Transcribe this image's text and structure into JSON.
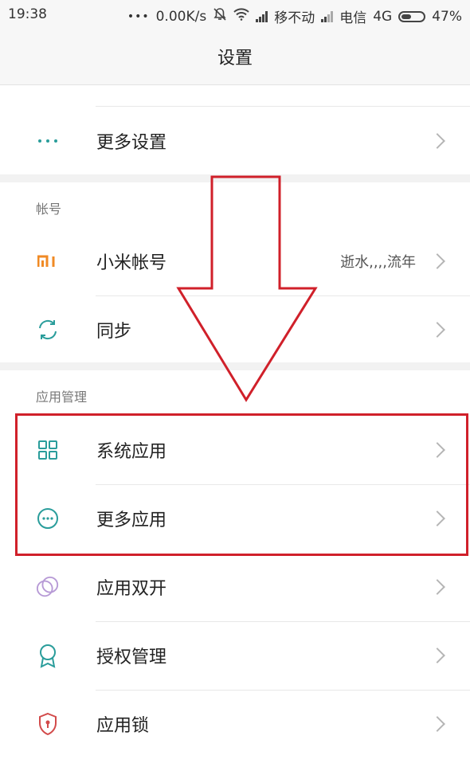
{
  "status_bar": {
    "time": "19:38",
    "dots": "•••",
    "speed": "0.00K/s",
    "carrier1": "移不动",
    "carrier2": "电信",
    "network": "4G",
    "battery": "47%",
    "battery_level": 0.47
  },
  "header": {
    "title": "设置"
  },
  "groups": [
    {
      "items": [
        {
          "label": "更多设置",
          "icon": "more-dots-icon"
        }
      ]
    },
    {
      "header": "帐号",
      "items": [
        {
          "label": "小米帐号",
          "value": "逝水,,,,流年",
          "icon": "mi-logo-icon"
        },
        {
          "label": "同步",
          "icon": "sync-icon"
        }
      ]
    },
    {
      "header": "应用管理",
      "items": [
        {
          "label": "系统应用",
          "icon": "grid-icon"
        },
        {
          "label": "更多应用",
          "icon": "more-circle-icon"
        },
        {
          "label": "应用双开",
          "icon": "dual-circle-icon"
        },
        {
          "label": "授权管理",
          "icon": "badge-icon"
        },
        {
          "label": "应用锁",
          "icon": "shield-lock-icon"
        }
      ]
    }
  ],
  "colors": {
    "accent_teal": "#2a9d9b",
    "mi_orange": "#f08a24",
    "purple": "#b79ad6",
    "lock_red": "#d24a4a",
    "annotation_red": "#d0202a"
  }
}
